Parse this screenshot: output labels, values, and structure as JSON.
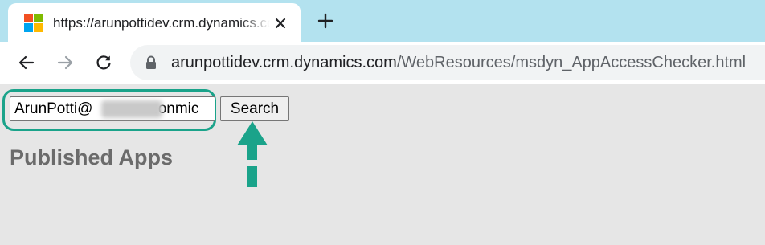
{
  "browser": {
    "tab": {
      "favicon": "microsoft-logo-icon",
      "title": "https://arunpottidev.crm.dynamics.com/WebResources/msdyn_AppAccessChecker.html",
      "close_icon": "close-icon"
    },
    "new_tab_icon": "plus-icon",
    "toolbar": {
      "back_icon": "arrow-left-icon",
      "forward_icon": "arrow-right-icon",
      "reload_icon": "reload-icon"
    },
    "address_bar": {
      "lock_icon": "lock-icon",
      "host": "arunpottidev.crm.dynamics.com",
      "path": "/WebResources/msdyn_AppAccessChecker.html"
    }
  },
  "page": {
    "user_input": {
      "value": "ArunPotti@",
      "value_suffix": ".onmic"
    },
    "search_label": "Search",
    "published_apps_heading": "Published Apps",
    "annotation_color": "#1aa38a"
  }
}
